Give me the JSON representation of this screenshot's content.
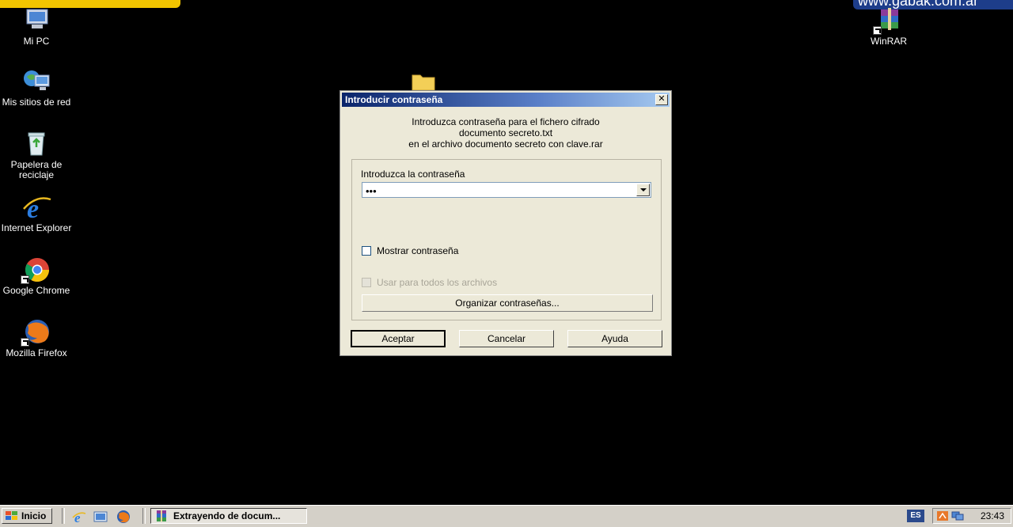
{
  "desktop": {
    "watermark_right": "www.gabak.com.ar",
    "icons": [
      {
        "label": "Mi PC"
      },
      {
        "label": "Mis sitios de red"
      },
      {
        "label": "Papelera de reciclaje"
      },
      {
        "label": "Internet Explorer"
      },
      {
        "label": "Google Chrome"
      },
      {
        "label": "Mozilla Firefox"
      },
      {
        "label": "WinRAR"
      }
    ]
  },
  "dialog": {
    "title": "Introducir contraseña",
    "close_glyph": "✕",
    "message_line1": "Introduzca contraseña para el fichero cifrado",
    "message_line2": "documento secreto.txt",
    "message_line3": "en el archivo documento secreto con clave.rar",
    "password_label": "Introduzca la contraseña",
    "password_value": "•••",
    "show_password_label": "Mostrar contraseña",
    "use_for_all_label": "Usar para todos los archivos",
    "organize_button": "Organizar contraseñas...",
    "ok_button": "Aceptar",
    "cancel_button": "Cancelar",
    "help_button": "Ayuda"
  },
  "taskbar": {
    "start_label": "Inicio",
    "task_label": "Extrayendo de docum...",
    "language": "ES",
    "clock": "23:43"
  },
  "colors": {
    "desktop_bg": "#000000",
    "dialog_bg": "#ece9d8",
    "titlebar_start": "#0a246a",
    "titlebar_end": "#a6caf0",
    "taskbar_bg": "#d4d0c8"
  }
}
